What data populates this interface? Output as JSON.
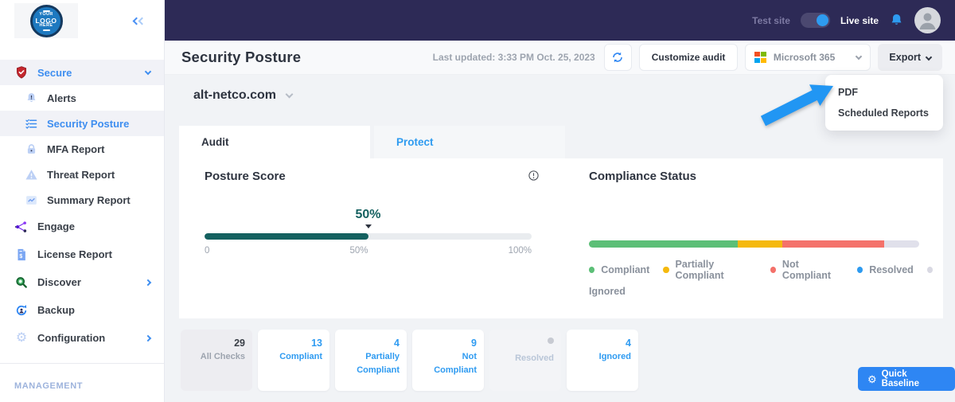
{
  "topbar": {
    "test_site_label": "Test site",
    "live_site_label": "Live site",
    "toggle_state": "live"
  },
  "logo": {
    "line1": "YOUR",
    "line2": "LOGO",
    "line3": "HERE"
  },
  "sidebar": {
    "items": [
      {
        "label": "Secure",
        "icon": "shield",
        "active": true,
        "chevron": "down"
      },
      {
        "label": "Alerts",
        "icon": "bell-alert"
      },
      {
        "label": "Security Posture",
        "icon": "checklist",
        "active": true
      },
      {
        "label": "MFA Report",
        "icon": "lock"
      },
      {
        "label": "Threat Report",
        "icon": "warning-triangle"
      },
      {
        "label": "Summary Report",
        "icon": "line-chart"
      },
      {
        "label": "Engage",
        "icon": "network"
      },
      {
        "label": "License Report",
        "icon": "invoice"
      },
      {
        "label": "Discover",
        "icon": "magnifier",
        "chevron": "right"
      },
      {
        "label": "Backup",
        "icon": "restore"
      },
      {
        "label": "Configuration",
        "icon": "gear",
        "chevron": "right"
      }
    ],
    "section_label": "MANAGEMENT"
  },
  "header": {
    "title": "Security Posture",
    "last_updated": "Last updated: 3:33 PM Oct. 25, 2023",
    "customize_button": "Customize audit",
    "product_selector": "Microsoft 365",
    "export_button": "Export"
  },
  "export_menu": {
    "items": [
      {
        "label": "PDF"
      },
      {
        "label": "Scheduled Reports"
      }
    ]
  },
  "site_selector": {
    "value": "alt-netco.com"
  },
  "tabs": [
    {
      "label": "Audit",
      "active": true
    },
    {
      "label": "Protect",
      "active": false
    }
  ],
  "posture": {
    "title": "Posture Score",
    "value": 50,
    "value_label": "50%",
    "scale": [
      "0",
      "50%",
      "100%"
    ]
  },
  "compliance": {
    "title": "Compliance Status",
    "segments": [
      {
        "name": "Compliant",
        "pct": 45,
        "color": "#5cbf77"
      },
      {
        "name": "Partially Compliant",
        "pct": 13.5,
        "color": "#f5b90d"
      },
      {
        "name": "Not Compliant",
        "pct": 31,
        "color": "#f4716a"
      },
      {
        "name": "Ignored",
        "pct": 10.5,
        "color": "#e0e0eb"
      }
    ],
    "legend": [
      {
        "label": "Compliant",
        "color": "#5cbf77"
      },
      {
        "label": "Partially Compliant",
        "color": "#f5b90d"
      },
      {
        "label": "Not Compliant",
        "color": "#f4716a"
      },
      {
        "label": "Resolved",
        "color": "#2e9bf0"
      },
      {
        "label": "Ignored",
        "color": "#d9d9e3"
      }
    ]
  },
  "summary_cards": [
    {
      "value": "29",
      "label": "All Checks",
      "state": "neutral"
    },
    {
      "value": "13",
      "label": "Compliant",
      "state": "default"
    },
    {
      "value": "4",
      "label": "Partially Compliant",
      "state": "default"
    },
    {
      "value": "9",
      "label": "Not Compliant",
      "state": "default"
    },
    {
      "value": "",
      "label": "Resolved",
      "state": "disabled"
    },
    {
      "value": "4",
      "label": "Ignored",
      "state": "default"
    }
  ],
  "quick_baseline_button": "Quick Baseline",
  "colors": {
    "topbar_bg": "#2d2a56",
    "accent_blue": "#2e9bf0",
    "sidebar_blue": "#3e8ef0",
    "posture_teal": "#156160",
    "secure_red": "#c4272e",
    "annotation_arrow": "#2196f3"
  }
}
